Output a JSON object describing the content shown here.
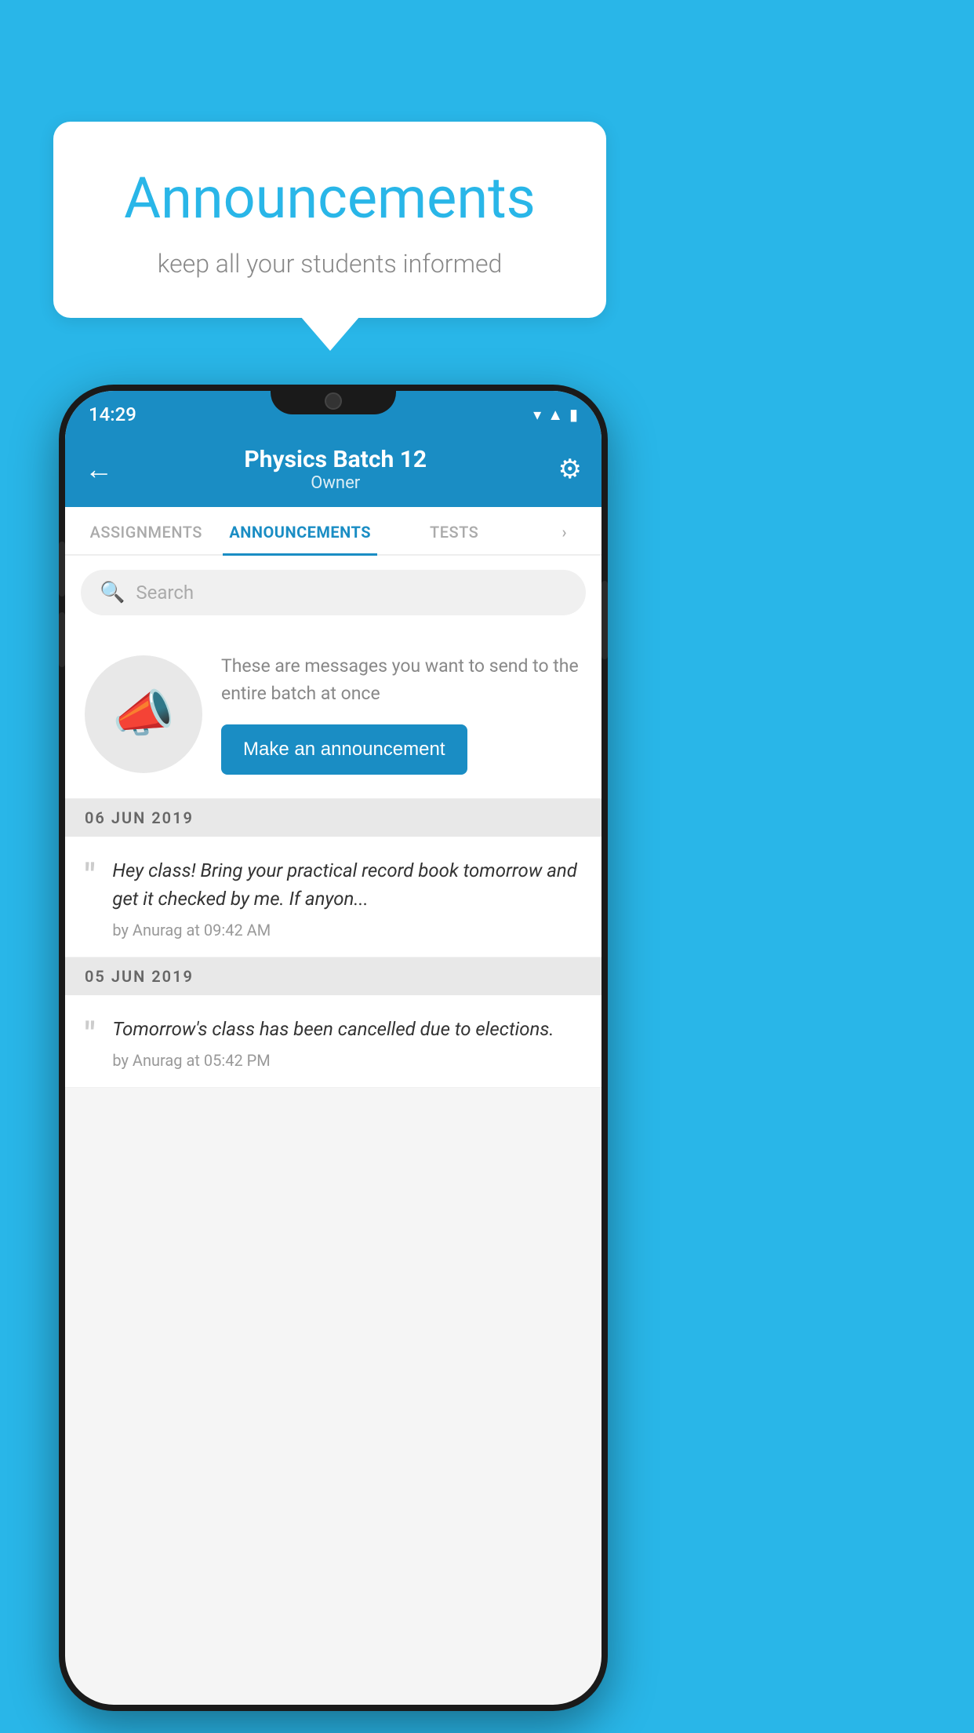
{
  "background": {
    "color": "#29b6e8"
  },
  "speech_bubble": {
    "title": "Announcements",
    "subtitle": "keep all your students informed"
  },
  "phone": {
    "status_bar": {
      "time": "14:29",
      "icons": [
        "wifi",
        "signal",
        "battery"
      ]
    },
    "header": {
      "title": "Physics Batch 12",
      "subtitle": "Owner",
      "back_label": "←",
      "gear_label": "⚙"
    },
    "tabs": [
      {
        "label": "ASSIGNMENTS",
        "active": false
      },
      {
        "label": "ANNOUNCEMENTS",
        "active": true
      },
      {
        "label": "TESTS",
        "active": false
      },
      {
        "label": "›",
        "active": false,
        "partial": true
      }
    ],
    "search": {
      "placeholder": "Search"
    },
    "promo": {
      "description": "These are messages you want to send to the entire batch at once",
      "button_label": "Make an announcement"
    },
    "announcements": [
      {
        "date": "06  JUN  2019",
        "text": "Hey class! Bring your practical record book tomorrow and get it checked by me. If anyon...",
        "meta": "by Anurag at 09:42 AM"
      },
      {
        "date": "05  JUN  2019",
        "text": "Tomorrow's class has been cancelled due to elections.",
        "meta": "by Anurag at 05:42 PM"
      }
    ]
  }
}
